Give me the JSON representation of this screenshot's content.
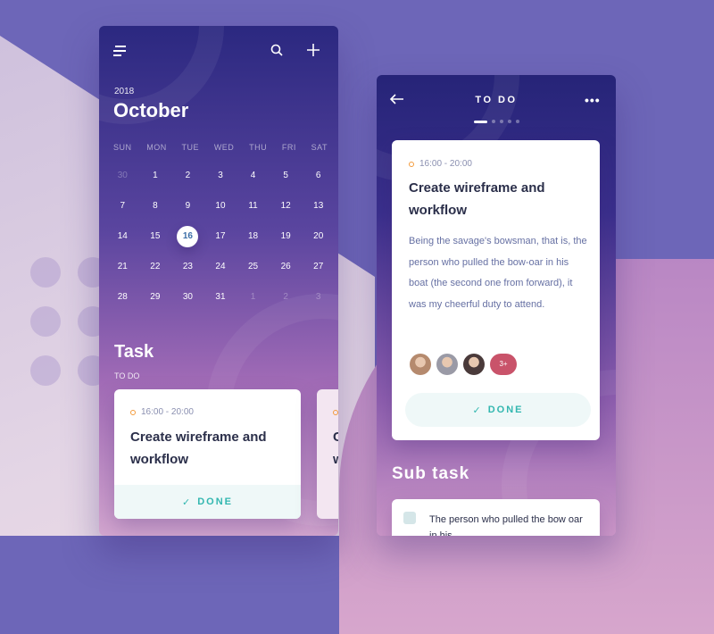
{
  "calendar_screen": {
    "year": "2018",
    "month": "October",
    "weekdays": [
      "SUN",
      "MON",
      "TUE",
      "WED",
      "THU",
      "FRI",
      "SAT"
    ],
    "days": [
      {
        "d": "30",
        "muted": true
      },
      {
        "d": "1"
      },
      {
        "d": "2"
      },
      {
        "d": "3"
      },
      {
        "d": "4"
      },
      {
        "d": "5"
      },
      {
        "d": "6"
      },
      {
        "d": "7"
      },
      {
        "d": "8"
      },
      {
        "d": "9"
      },
      {
        "d": "10"
      },
      {
        "d": "11"
      },
      {
        "d": "12"
      },
      {
        "d": "13"
      },
      {
        "d": "14"
      },
      {
        "d": "15"
      },
      {
        "d": "16",
        "selected": true
      },
      {
        "d": "17"
      },
      {
        "d": "18"
      },
      {
        "d": "19"
      },
      {
        "d": "20"
      },
      {
        "d": "21"
      },
      {
        "d": "22"
      },
      {
        "d": "23"
      },
      {
        "d": "24"
      },
      {
        "d": "25"
      },
      {
        "d": "26"
      },
      {
        "d": "27"
      },
      {
        "d": "28"
      },
      {
        "d": "29"
      },
      {
        "d": "30"
      },
      {
        "d": "31"
      },
      {
        "d": "1",
        "muted": true
      },
      {
        "d": "2",
        "muted": true
      },
      {
        "d": "3",
        "muted": true
      }
    ],
    "task_heading": "Task",
    "task_subheading": "TO DO",
    "task_card": {
      "time": "16:00 - 20:00",
      "title": "Create wireframe and workflow",
      "done_label": "DONE"
    },
    "peek_card": {
      "title_start": "C",
      "title_line2_start": "w"
    }
  },
  "detail_screen": {
    "title": "TO DO",
    "pager": {
      "count": 5,
      "active": 0
    },
    "card": {
      "time": "16:00 - 20:00",
      "title": "Create wireframe and workflow",
      "description": "Being the savage's bowsman, that is, the person who pulled the bow-oar in his boat (the second one from forward), it was my cheerful duty to attend.",
      "avatars": [
        "#b58a6e",
        "#9a9aa6",
        "#4a3a3a"
      ],
      "more_label": "3+",
      "more_color": "#c9536a",
      "done_label": "DONE"
    },
    "subtask_heading": "Sub task",
    "subtask": {
      "text": "The person who pulled the bow oar in his"
    }
  },
  "colors": {
    "accent": "#33b7b0",
    "time_dot": "#f39a3a",
    "selected_day_text": "#3d6fa8"
  }
}
